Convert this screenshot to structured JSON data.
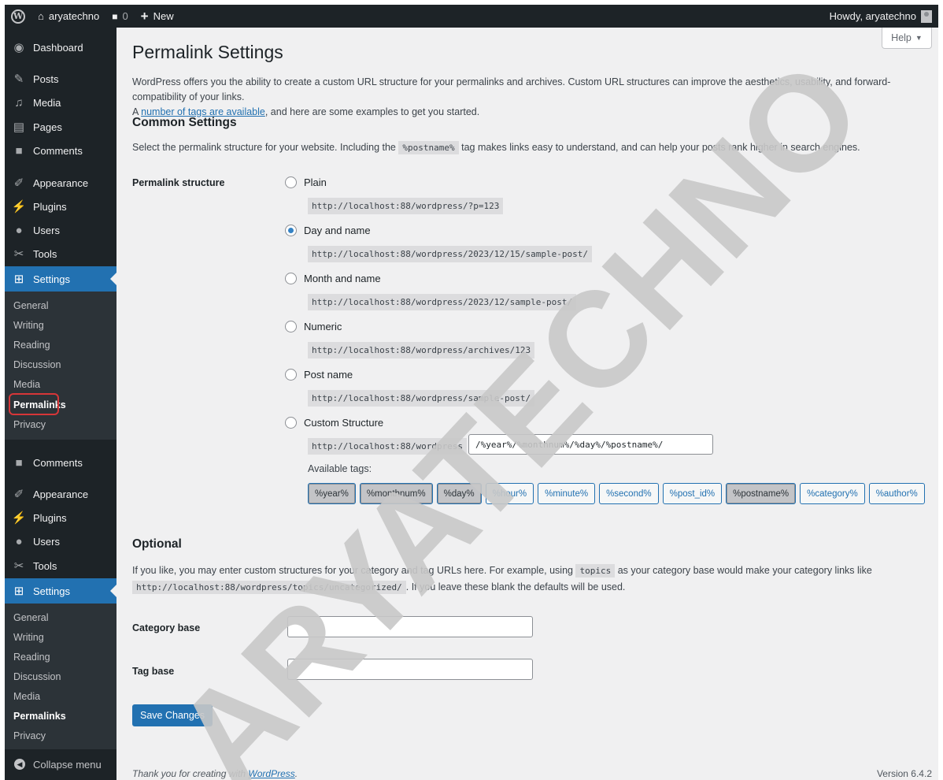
{
  "adminbar": {
    "site_name": "aryatechno",
    "comments_count": "0",
    "new_label": "New",
    "howdy": "Howdy, aryatechno"
  },
  "sidebar": {
    "items_top": [
      {
        "label": "Dashboard",
        "icon": "dashboard-icon"
      },
      {
        "label": "Posts",
        "icon": "pin-icon"
      },
      {
        "label": "Media",
        "icon": "media-icon"
      },
      {
        "label": "Pages",
        "icon": "pages-icon"
      },
      {
        "label": "Comments",
        "icon": "comments-icon"
      },
      {
        "label": "Appearance",
        "icon": "brush-icon"
      },
      {
        "label": "Plugins",
        "icon": "plugin-icon"
      },
      {
        "label": "Users",
        "icon": "users-icon"
      },
      {
        "label": "Tools",
        "icon": "wrench-icon"
      },
      {
        "label": "Settings",
        "icon": "settings-icon"
      }
    ],
    "submenu": [
      "General",
      "Writing",
      "Reading",
      "Discussion",
      "Media",
      "Permalinks",
      "Privacy"
    ],
    "submenu_current": "Permalinks",
    "items_bottom": [
      {
        "label": "Comments",
        "icon": "comments-icon"
      },
      {
        "label": "Appearance",
        "icon": "brush-icon"
      },
      {
        "label": "Plugins",
        "icon": "plugin-icon"
      },
      {
        "label": "Users",
        "icon": "users-icon"
      },
      {
        "label": "Tools",
        "icon": "wrench-icon"
      },
      {
        "label": "Settings",
        "icon": "settings-icon"
      }
    ],
    "submenu2": [
      "General",
      "Writing",
      "Reading",
      "Discussion",
      "Media",
      "Permalinks",
      "Privacy"
    ],
    "collapse": "Collapse menu"
  },
  "main": {
    "help_label": "Help",
    "title": "Permalink Settings",
    "intro_1": "WordPress offers you the ability to create a custom URL structure for your permalinks and archives. Custom URL structures can improve the aesthetics, usability, and forward-compatibility of your links.",
    "intro_2_pre": "A ",
    "intro_2_link": "number of tags are available",
    "intro_2_post": ", and here are some examples to get you started.",
    "common_heading": "Common Settings",
    "common_desc_pre": "Select the permalink structure for your website. Including the",
    "common_desc_code": "%postname%",
    "common_desc_post": "tag makes links easy to understand, and can help your posts rank higher in search engines.",
    "structure_label": "Permalink structure",
    "options": [
      {
        "label": "Plain",
        "url": "http://localhost:88/wordpress/?p=123",
        "checked": false
      },
      {
        "label": "Day and name",
        "url": "http://localhost:88/wordpress/2023/12/15/sample-post/",
        "checked": true
      },
      {
        "label": "Month and name",
        "url": "http://localhost:88/wordpress/2023/12/sample-post/",
        "checked": false
      },
      {
        "label": "Numeric",
        "url": "http://localhost:88/wordpress/archives/123",
        "checked": false
      },
      {
        "label": "Post name",
        "url": "http://localhost:88/wordpress/sample-post/",
        "checked": false
      },
      {
        "label": "Custom Structure",
        "url": "",
        "checked": false
      }
    ],
    "custom_prefix": "http://localhost:88/wordpress",
    "custom_value": "/%year%/%monthnum%/%day%/%postname%/",
    "available_tags_label": "Available tags:",
    "tags": [
      {
        "label": "%year%",
        "on": true
      },
      {
        "label": "%monthnum%",
        "on": true
      },
      {
        "label": "%day%",
        "on": true
      },
      {
        "label": "%hour%",
        "on": false
      },
      {
        "label": "%minute%",
        "on": false
      },
      {
        "label": "%second%",
        "on": false
      },
      {
        "label": "%post_id%",
        "on": false
      },
      {
        "label": "%postname%",
        "on": true
      },
      {
        "label": "%category%",
        "on": false
      },
      {
        "label": "%author%",
        "on": false
      }
    ],
    "optional_heading": "Optional",
    "optional_desc_pre": "If you like, you may enter custom structures for your category and tag URLs here. For example, using",
    "optional_desc_code": "topics",
    "optional_desc_mid": "as your category base would make your category links like",
    "optional_desc_code2": "http://localhost:88/wordpress/topics/uncategorized/",
    "optional_desc_post": ". If you leave these blank the defaults will be used.",
    "category_base_label": "Category base",
    "category_base_value": "",
    "tag_base_label": "Tag base",
    "tag_base_value": "",
    "save_label": "Save Changes"
  },
  "footer": {
    "thanks_pre": "Thank you for creating with ",
    "thanks_link": "WordPress",
    "thanks_post": ".",
    "version": "Version 6.4.2"
  },
  "watermark": {
    "text": "ARYATECHNO",
    "color": "#c8c8c8"
  },
  "colors": {
    "accent": "#2271b1",
    "admin_dark": "#1d2327",
    "highlight": "#d63638"
  }
}
